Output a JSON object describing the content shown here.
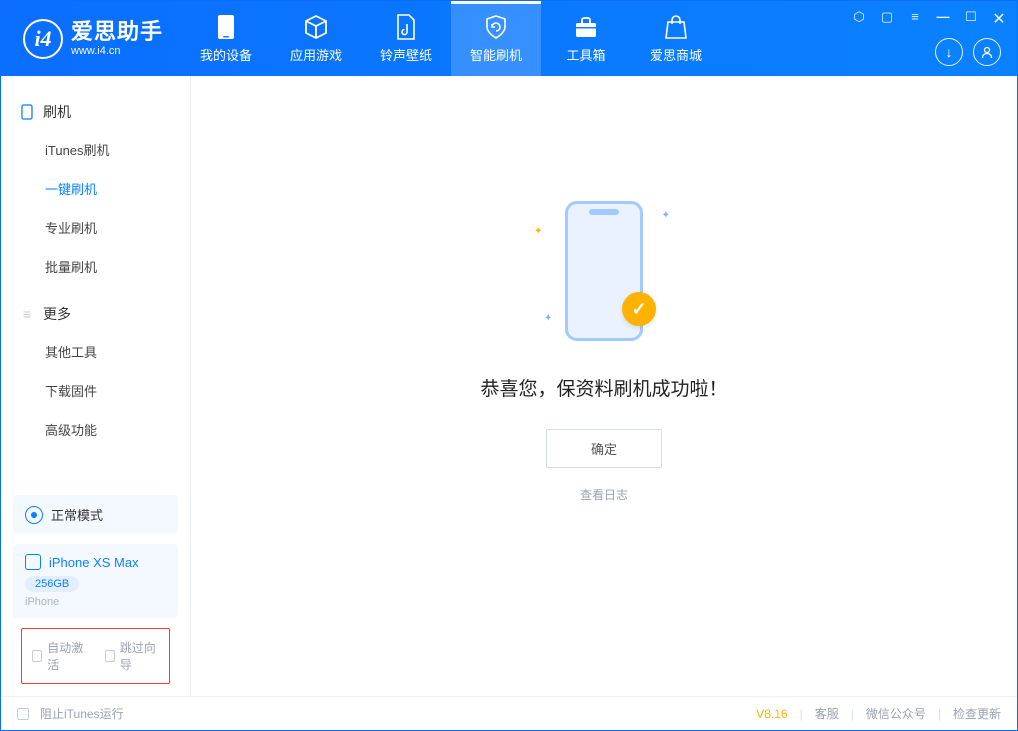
{
  "app": {
    "title": "爱思助手",
    "subtitle": "www.i4.cn"
  },
  "nav": {
    "tabs": [
      {
        "label": "我的设备"
      },
      {
        "label": "应用游戏"
      },
      {
        "label": "铃声壁纸"
      },
      {
        "label": "智能刷机"
      },
      {
        "label": "工具箱"
      },
      {
        "label": "爱思商城"
      }
    ]
  },
  "sidebar": {
    "section1": {
      "title": "刷机",
      "items": [
        {
          "label": "iTunes刷机"
        },
        {
          "label": "一键刷机"
        },
        {
          "label": "专业刷机"
        },
        {
          "label": "批量刷机"
        }
      ]
    },
    "section2": {
      "title": "更多",
      "items": [
        {
          "label": "其他工具"
        },
        {
          "label": "下载固件"
        },
        {
          "label": "高级功能"
        }
      ]
    },
    "mode": {
      "label": "正常模式"
    },
    "device": {
      "name": "iPhone XS Max",
      "capacity": "256GB",
      "type": "iPhone"
    },
    "options": {
      "auto_activate": "自动激活",
      "skip_guide": "跳过向导"
    }
  },
  "main": {
    "success_title": "恭喜您，保资料刷机成功啦！",
    "ok_button": "确定",
    "view_log": "查看日志"
  },
  "footer": {
    "block_itunes": "阻止iTunes运行",
    "version": "V8.16",
    "links": {
      "service": "客服",
      "wechat": "微信公众号",
      "update": "检查更新"
    }
  }
}
